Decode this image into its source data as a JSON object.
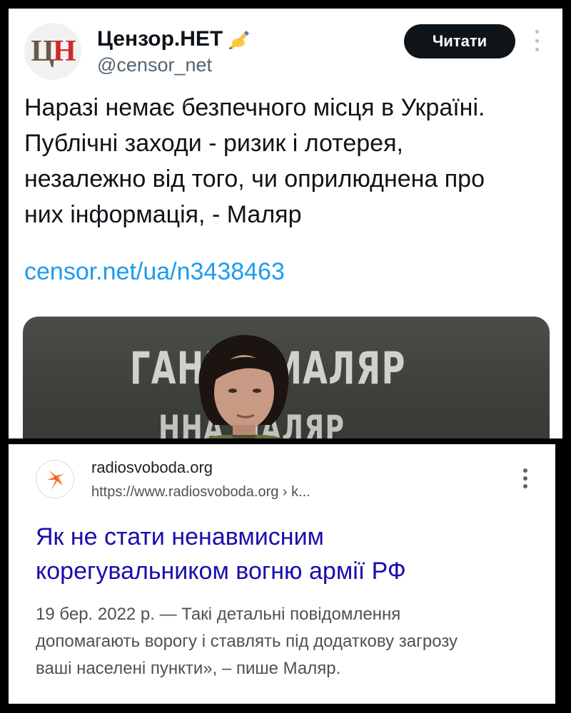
{
  "tweet": {
    "avatar_logo_1": "Ц",
    "avatar_logo_2": "Н",
    "display_name": "Цензор.НЕТ",
    "verified_icon": "writing-hand-emoji",
    "handle": "@censor_net",
    "follow_label": "Читати",
    "text_lines": [
      "Наразі немає безпечного місця в Україні.",
      "Публічні заходи - ризик і лотерея,",
      "незалежно від того, чи оприлюднена про",
      "них інформація, - Маляр"
    ],
    "link": "censor.net/ua/n3438463",
    "media_text_1": "ГАННА МАЛЯР",
    "media_text_2": "ННА МАЛЯР"
  },
  "result": {
    "site_name": "radiosvoboda.org",
    "site_url": "https://www.radiosvoboda.org › k...",
    "title_lines": [
      "Як не стати ненавмисним",
      "корегувальником вогню армії РФ"
    ],
    "snippet_lines": [
      "19 бер. 2022 р. — Такі детальні повідомлення",
      "допомагають ворогу і ставлять під додаткову загрозу",
      "ваші населені пункти», – пише Маляр."
    ]
  },
  "colors": {
    "tweet_text": "#0f1419",
    "tweet_link": "#1d9bf0",
    "follow_bg": "#0f1419",
    "result_title": "#1a0dab",
    "result_snippet": "#4d5156",
    "brand_red": "#d1282a",
    "favicon_orange": "#f4793b"
  }
}
